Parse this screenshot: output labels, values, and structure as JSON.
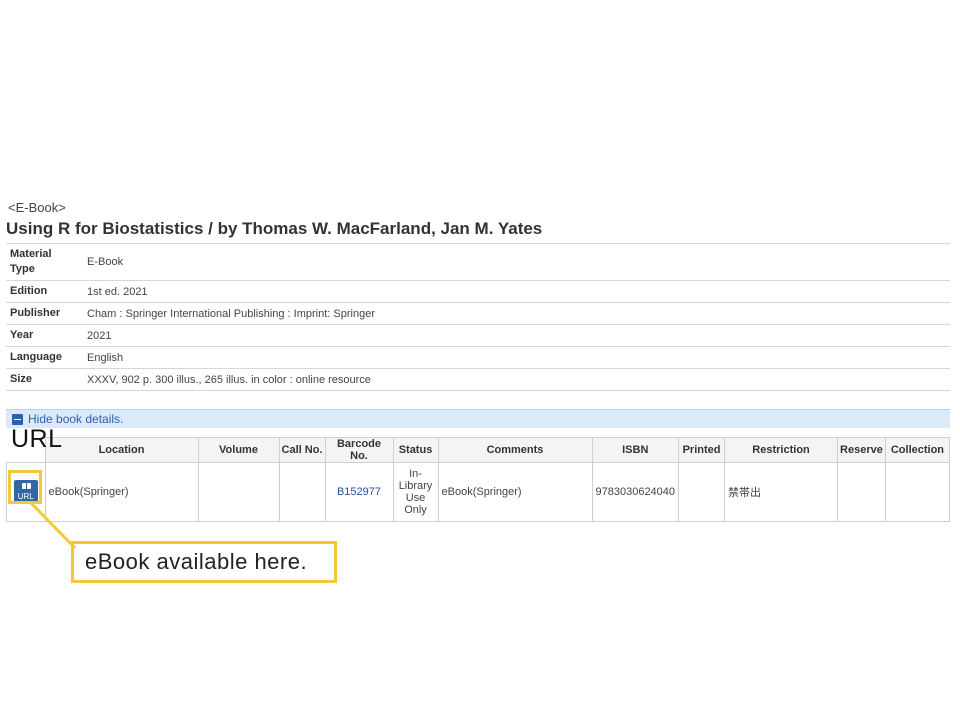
{
  "book": {
    "type_label": "<E-Book>",
    "title": "Using R for Biostatistics / by Thomas W. MacFarland, Jan M. Yates"
  },
  "details": [
    {
      "label": "Material Type",
      "value": "E-Book"
    },
    {
      "label": "Edition",
      "value": "1st ed. 2021"
    },
    {
      "label": "Publisher",
      "value": "Cham : Springer International Publishing : Imprint: Springer"
    },
    {
      "label": "Year",
      "value": "2021"
    },
    {
      "label": "Language",
      "value": "English"
    },
    {
      "label": "Size",
      "value": "XXXV, 902 p. 300 illus., 265 illus. in color : online resource"
    }
  ],
  "toggle": {
    "label": "Hide book details."
  },
  "annotation": {
    "url_heading": "URL",
    "callout_text": "eBook available here.",
    "highlight_color": "#f2c939"
  },
  "holdings": {
    "headers": [
      "Location",
      "Volume",
      "Call No.",
      "Barcode No.",
      "Status",
      "Comments",
      "ISBN",
      "Printed",
      "Restriction",
      "Reserve",
      "Collection"
    ],
    "url_button_label": "URL",
    "url_button_icon": "book-icon",
    "rows": [
      {
        "location": "eBook(Springer)",
        "volume": "",
        "call_no": "",
        "barcode": "B152977",
        "status": "In-Library Use Only",
        "comments": "eBook(Springer)",
        "isbn": "9783030624040",
        "printed": "",
        "restriction": "禁帯出",
        "reserve": "",
        "collection": ""
      }
    ]
  },
  "colors": {
    "accent": "#2c62ad",
    "toggle_bg": "#dbeafb",
    "url_button": "#3465a4",
    "link": "#2a4fa0"
  }
}
